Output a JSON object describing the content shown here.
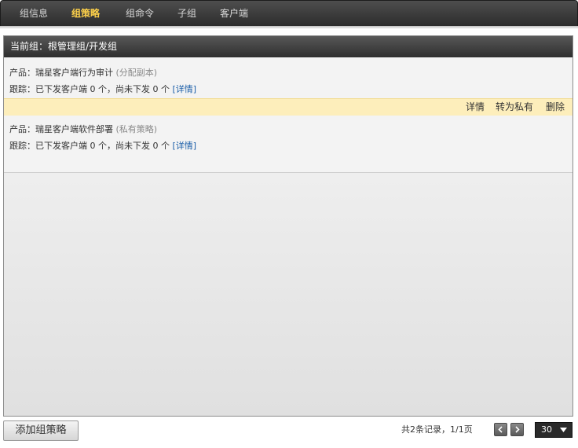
{
  "tabs": [
    {
      "label": "组信息",
      "active": false
    },
    {
      "label": "组策略",
      "active": true
    },
    {
      "label": "组命令",
      "active": false
    },
    {
      "label": "子组",
      "active": false
    },
    {
      "label": "客户端",
      "active": false
    }
  ],
  "panel": {
    "header": "当前组：根管理组/开发组"
  },
  "policies": [
    {
      "product_label": "产品：",
      "product_name": "瑞星客户端行为审计",
      "tag": "(分配副本)",
      "track_label": "跟踪：",
      "track_prefix": "已下发客户端",
      "sent_count": "0",
      "unit1": "个，尚未下发",
      "pending_count": "0",
      "unit2": "个",
      "detail_link": "[详情]"
    },
    {
      "product_label": "产品：",
      "product_name": "瑞星客户端软件部署",
      "tag": "(私有策略)",
      "track_label": "跟踪：",
      "track_prefix": "已下发客户端",
      "sent_count": "0",
      "unit1": "个，尚未下发",
      "pending_count": "0",
      "unit2": "个",
      "detail_link": "[详情]"
    }
  ],
  "actions": {
    "detail": "详情",
    "make_private": "转为私有",
    "delete": "删除"
  },
  "footer": {
    "add_button": "添加组策略",
    "records": "共2条记录，1/1页",
    "page_size": "30"
  },
  "colors": {
    "active_tab": "#ffd24a",
    "link": "#1a5ea8",
    "action_bar": "#fdeebb"
  }
}
